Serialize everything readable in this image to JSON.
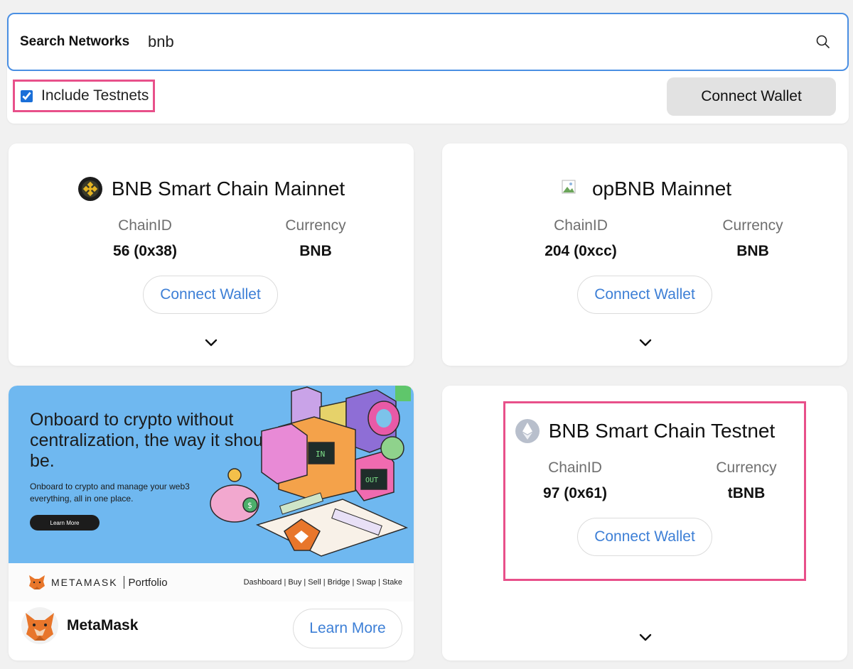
{
  "search": {
    "label": "Search Networks",
    "value": "bnb"
  },
  "filters": {
    "include_testnets_label": "Include Testnets",
    "include_testnets_checked": true
  },
  "header": {
    "connect_wallet_label": "Connect Wallet"
  },
  "networks": [
    {
      "name": "BNB Smart Chain Mainnet",
      "chainid_label": "ChainID",
      "chainid_value": "56 (0x38)",
      "currency_label": "Currency",
      "currency_value": "BNB",
      "connect_label": "Connect Wallet",
      "icon": "bnb-logo-icon"
    },
    {
      "name": "opBNB Mainnet",
      "chainid_label": "ChainID",
      "chainid_value": "204 (0xcc)",
      "currency_label": "Currency",
      "currency_value": "BNB",
      "connect_label": "Connect Wallet",
      "icon": "broken-image-icon"
    },
    {
      "name": "BNB Smart Chain Testnet",
      "chainid_label": "ChainID",
      "chainid_value": "97 (0x61)",
      "currency_label": "Currency",
      "currency_value": "tBNB",
      "connect_label": "Connect Wallet",
      "icon": "ethereum-logo-icon"
    }
  ],
  "ad": {
    "headline": "Onboard to crypto without centralization, the way it should be.",
    "subtext": "Onboard to crypto and manage your web3 everything, all in one place.",
    "banner_button": "Learn More",
    "brand_wordmark": "METAMASK",
    "brand_product": "Portfolio",
    "links": "Dashboard | Buy | Sell | Bridge | Swap | Stake",
    "sponsor_name": "MetaMask",
    "learn_more_label": "Learn More"
  },
  "colors": {
    "accent_blue": "#3d7fd6",
    "highlight_pink": "#e8508a",
    "ad_background": "#6fb8f0"
  }
}
